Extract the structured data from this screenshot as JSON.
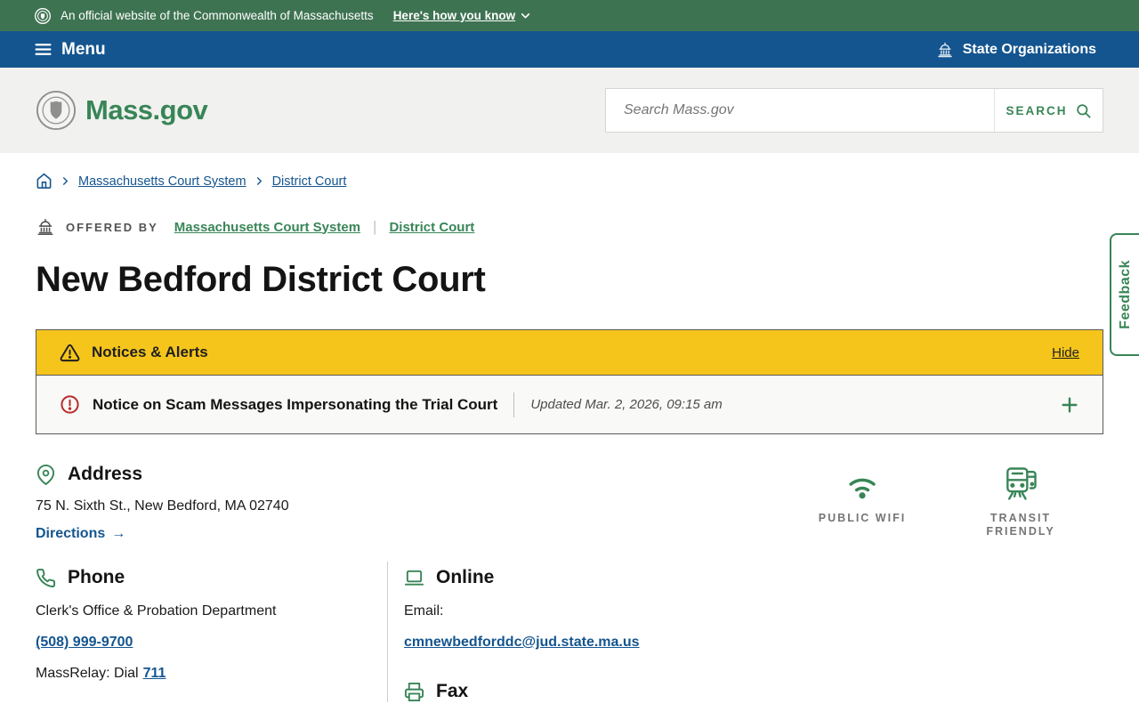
{
  "banner": {
    "text": "An official website of the Commonwealth of Massachusetts",
    "how_link": "Here's how you know"
  },
  "nav": {
    "menu_label": "Menu",
    "state_orgs_label": "State Organizations"
  },
  "header": {
    "logo_text": "Mass.gov",
    "search_placeholder": "Search Mass.gov",
    "search_button": "SEARCH"
  },
  "breadcrumb": {
    "items": [
      {
        "label": "Massachusetts Court System"
      },
      {
        "label": "District Court"
      }
    ]
  },
  "offered_by": {
    "label": "OFFERED BY",
    "links": [
      {
        "label": "Massachusetts Court System"
      },
      {
        "label": "District Court"
      }
    ]
  },
  "page": {
    "title": "New Bedford District Court"
  },
  "alerts": {
    "header": "Notices & Alerts",
    "hide_label": "Hide",
    "items": [
      {
        "title": "Notice on Scam Messages Impersonating the Trial Court",
        "updated": "Updated Mar. 2, 2026, 09:15 am"
      }
    ]
  },
  "address": {
    "heading": "Address",
    "line": "75 N. Sixth St., New Bedford, MA 02740",
    "directions_label": "Directions",
    "arrow": "→"
  },
  "amenities": [
    {
      "label": "PUBLIC WIFI",
      "icon": "wifi-icon"
    },
    {
      "label": "TRANSIT FRIENDLY",
      "icon": "transit-icon"
    }
  ],
  "phone": {
    "heading": "Phone",
    "dept": "Clerk's Office & Probation Department",
    "number": "(508) 999-9700",
    "massrelay_prefix": "MassRelay: Dial",
    "massrelay_number": "711"
  },
  "online": {
    "heading": "Online",
    "email_label": "Email:",
    "email": "cmnewbedforddc@jud.state.ma.us"
  },
  "fax": {
    "heading": "Fax"
  },
  "feedback": {
    "label": "Feedback"
  },
  "colors": {
    "brand_green": "#388557",
    "banner_green": "#3e7352",
    "nav_blue": "#14558f",
    "alert_yellow": "#f6c51b",
    "alert_red": "#b72c2c"
  }
}
